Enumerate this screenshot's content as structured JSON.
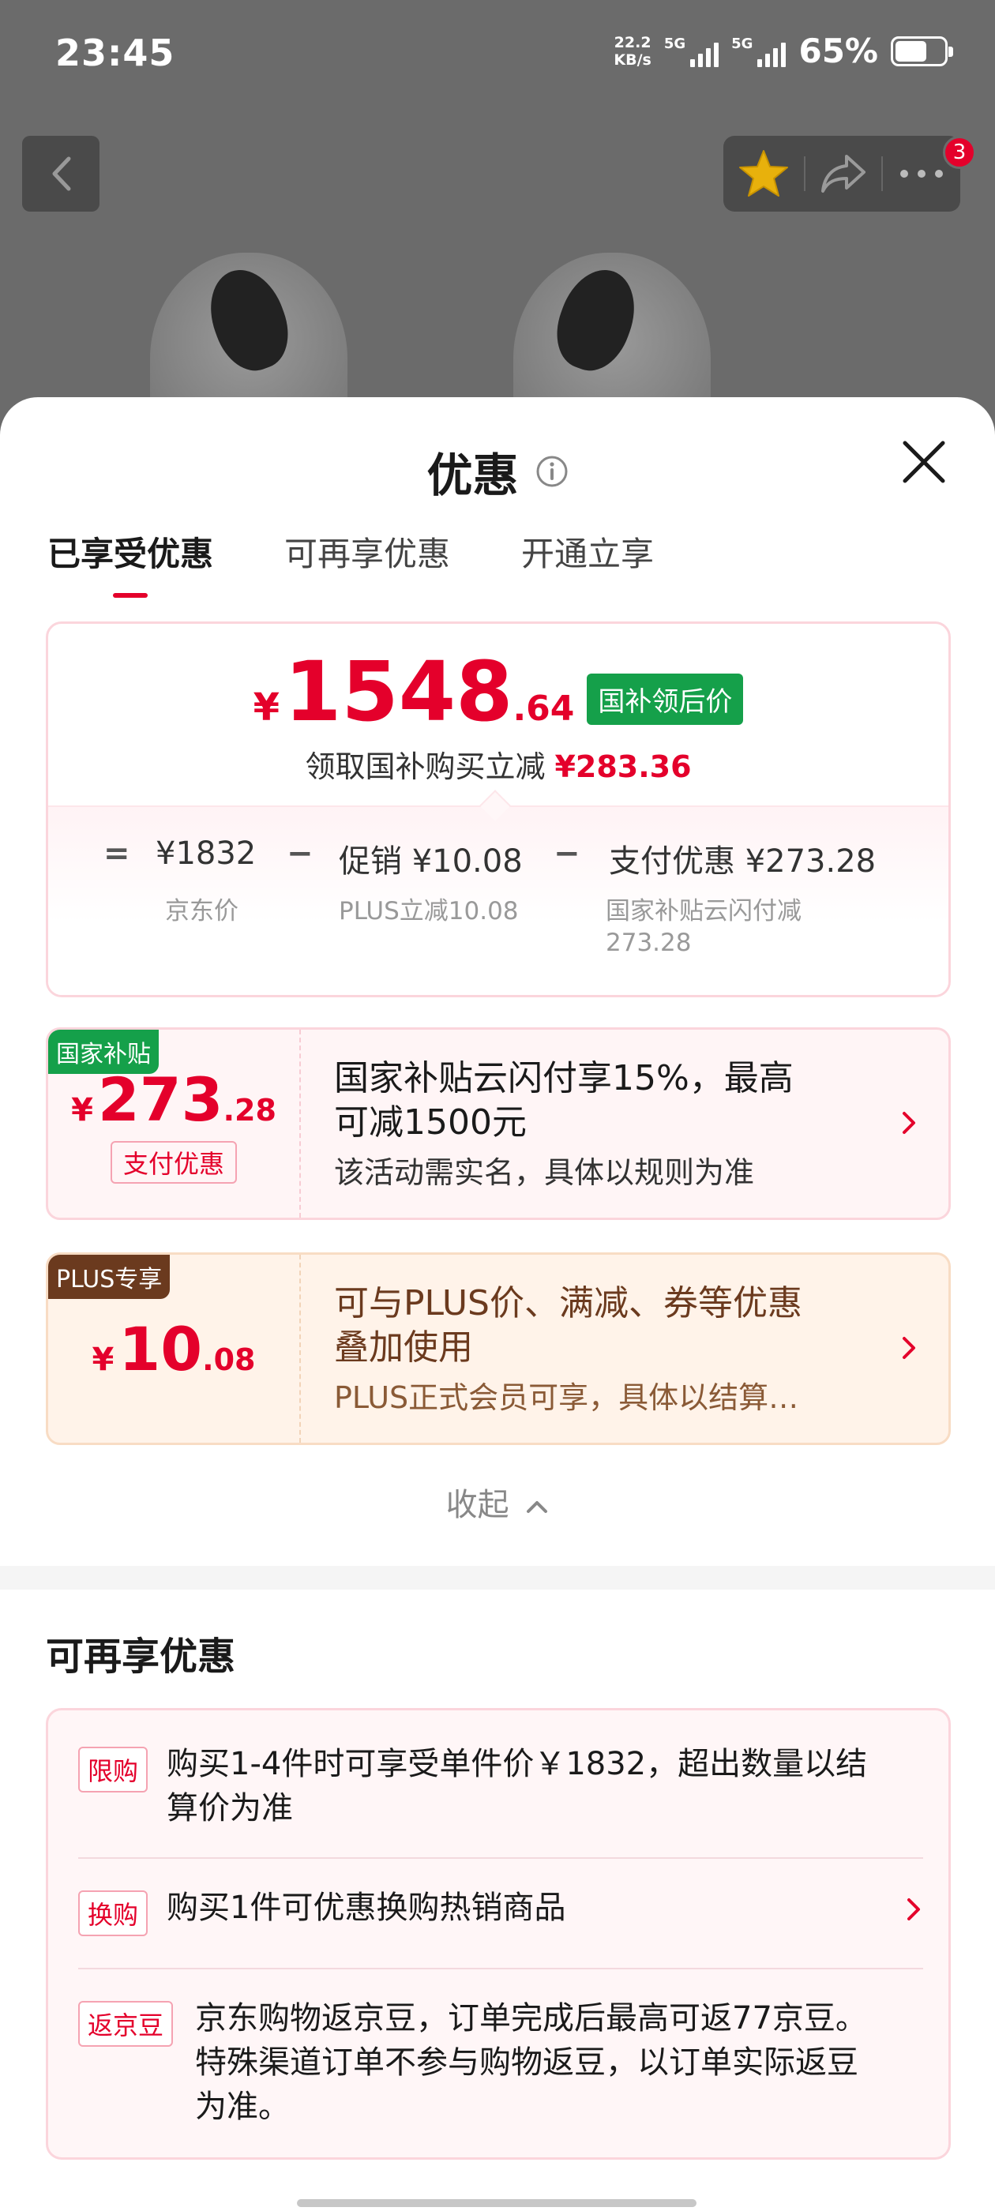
{
  "status_bar": {
    "time": "23:45",
    "net_speed_value": "22.2",
    "net_speed_unit": "KB/s",
    "sim1": "5G",
    "sim2": "5G",
    "battery_percent": "65%",
    "battery_level": 0.65
  },
  "nav": {
    "back_icon": "chevron-left-icon",
    "favorite_icon": "star-icon",
    "share_icon": "share-icon",
    "more_icon": "more-icon",
    "more_badge": "3"
  },
  "sheet": {
    "title": "优惠",
    "tabs": [
      {
        "label": "已享受优惠",
        "active": true
      },
      {
        "label": "可再享优惠",
        "active": false
      },
      {
        "label": "开通立享",
        "active": false
      }
    ]
  },
  "summary": {
    "currency": "¥",
    "final_price_int": "1548",
    "final_price_dec": ".64",
    "badge": "国补领后价",
    "reduce_label": "领取国补购买立减",
    "reduce_amount": "¥283.36",
    "formula": {
      "eq": "=",
      "minus": "−",
      "jd_price": "¥1832",
      "jd_price_label": "京东价",
      "promo": "促销 ¥10.08",
      "promo_label": "PLUS立减10.08",
      "pay": "支付优惠 ¥273.28",
      "pay_label_line1": "国家补贴云闪付减",
      "pay_label_line2": "273.28"
    }
  },
  "benefits": [
    {
      "corner": "国家补贴",
      "currency": "¥",
      "amount_int": "273",
      "amount_dec": ".28",
      "tag": "支付优惠",
      "desc_line1": "国家补贴云闪付享15%，最高",
      "desc_line2": "可减1500元",
      "note": "该活动需实名，具体以规则为准"
    },
    {
      "corner": "PLUS专享",
      "currency": "¥",
      "amount_int": "10",
      "amount_dec": ".08",
      "desc_line1": "可与PLUS价、满减、券等优惠",
      "desc_line2": "叠加使用",
      "note": "PLUS正式会员可享，具体以结算…"
    }
  ],
  "collapse_label": "收起",
  "more_section": {
    "title": "可再享优惠",
    "items": [
      {
        "label": "限购",
        "text_line1": "购买1-4件时可享受单件价￥1832，超出数量以结",
        "text_line2": "算价为准"
      },
      {
        "label": "换购",
        "text_line1": "购买1件可优惠换购热销商品"
      },
      {
        "label": "返京豆",
        "text_line1": "京东购物返京豆，订单完成后最高可返77京豆。",
        "text_line2": "特殊渠道订单不参与购物返豆，以订单实际返豆",
        "text_line3": "为准。"
      }
    ]
  },
  "colors": {
    "accent_red": "#e4002b",
    "subsidy_green": "#15a04a",
    "plus_brown": "#6b3a1e"
  }
}
